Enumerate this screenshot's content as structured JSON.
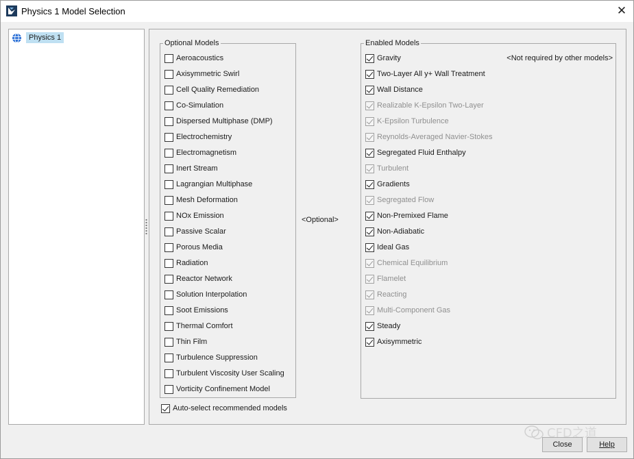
{
  "window": {
    "title": "Physics 1 Model Selection",
    "close_glyph": "✕"
  },
  "tree": {
    "items": [
      {
        "label": "Physics 1",
        "icon": "globe-icon"
      }
    ]
  },
  "optional": {
    "legend": "Optional Models",
    "items": [
      "Aeroacoustics",
      "Axisymmetric Swirl",
      "Cell Quality Remediation",
      "Co-Simulation",
      "Dispersed Multiphase (DMP)",
      "Electrochemistry",
      "Electromagnetism",
      "Inert Stream",
      "Lagrangian Multiphase",
      "Mesh Deformation",
      "NOx Emission",
      "Passive Scalar",
      "Porous Media",
      "Radiation",
      "Reactor Network",
      "Solution Interpolation",
      "Soot Emissions",
      "Thermal Comfort",
      "Thin Film",
      "Turbulence Suppression",
      "Turbulent Viscosity User Scaling",
      "Vorticity Confinement Model"
    ]
  },
  "middle_label": "<Optional>",
  "enabled": {
    "legend": "Enabled Models",
    "note": "<Not required by other models>",
    "items": [
      {
        "label": "Gravity",
        "enabled": true
      },
      {
        "label": "Two-Layer All y+ Wall Treatment",
        "enabled": true
      },
      {
        "label": "Wall Distance",
        "enabled": true
      },
      {
        "label": "Realizable K-Epsilon Two-Layer",
        "enabled": false
      },
      {
        "label": "K-Epsilon Turbulence",
        "enabled": false
      },
      {
        "label": "Reynolds-Averaged Navier-Stokes",
        "enabled": false
      },
      {
        "label": "Segregated Fluid Enthalpy",
        "enabled": true
      },
      {
        "label": "Turbulent",
        "enabled": false
      },
      {
        "label": "Gradients",
        "enabled": true
      },
      {
        "label": "Segregated Flow",
        "enabled": false
      },
      {
        "label": "Non-Premixed Flame",
        "enabled": true
      },
      {
        "label": "Non-Adiabatic",
        "enabled": true
      },
      {
        "label": "Ideal Gas",
        "enabled": true
      },
      {
        "label": "Chemical Equilibrium",
        "enabled": false
      },
      {
        "label": "Flamelet",
        "enabled": false
      },
      {
        "label": "Reacting",
        "enabled": false
      },
      {
        "label": "Multi-Component Gas",
        "enabled": false
      },
      {
        "label": "Steady",
        "enabled": true
      },
      {
        "label": "Axisymmetric",
        "enabled": true
      }
    ]
  },
  "auto_select": {
    "label": "Auto-select recommended models",
    "checked": true
  },
  "buttons": {
    "close": "Close",
    "help": "Help"
  },
  "watermark": {
    "text": "CFD之道"
  },
  "colors": {
    "selection": "#bfe0f2",
    "globe": "#2a6fd6",
    "app_icon": "#1d3a5c"
  }
}
